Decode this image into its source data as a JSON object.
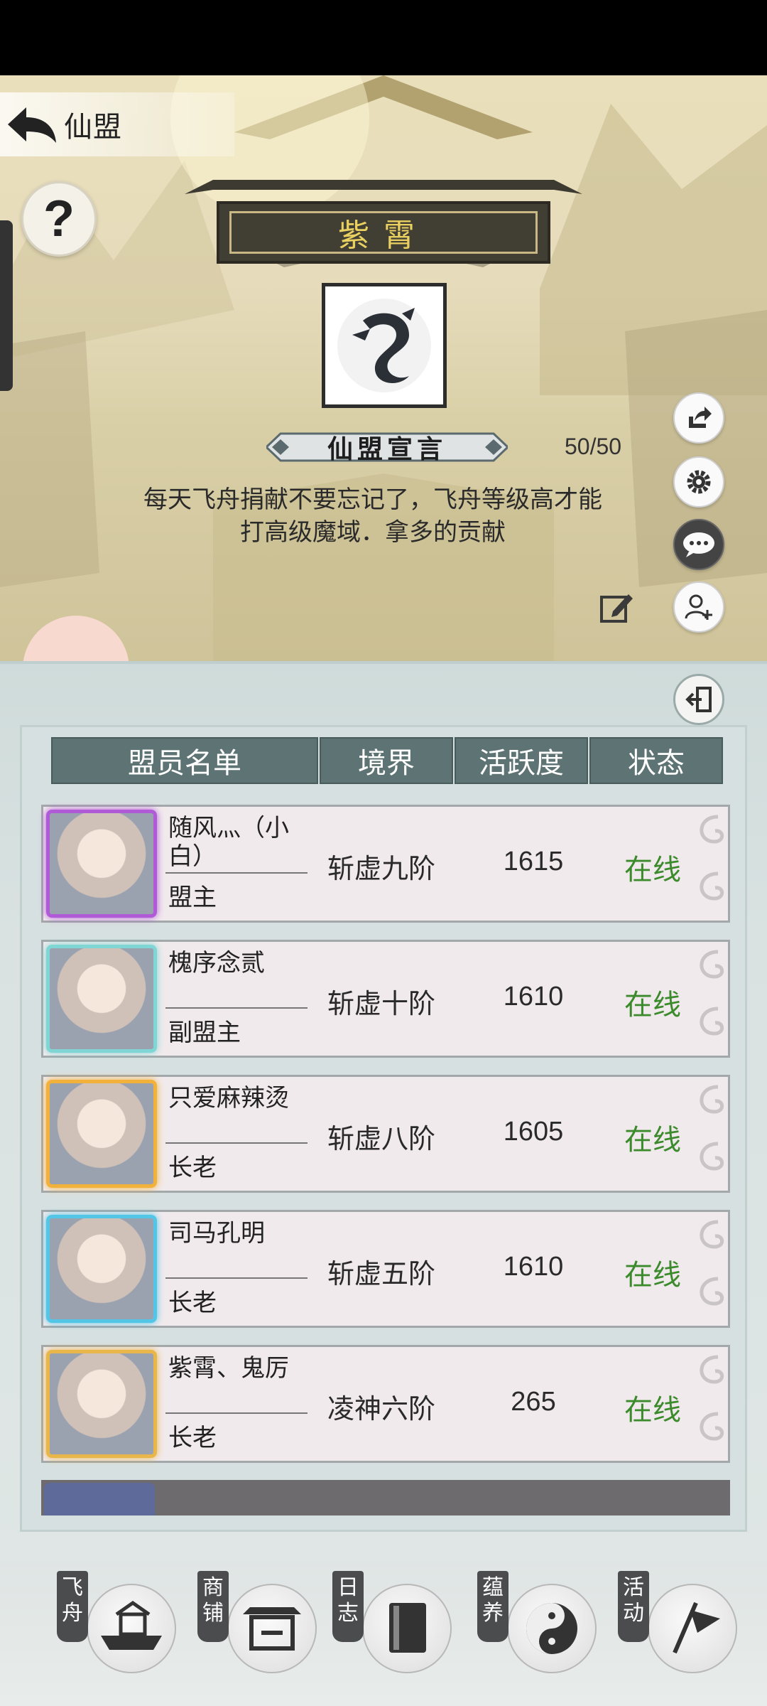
{
  "header": {
    "title": "仙盟"
  },
  "guild": {
    "name": "紫霄",
    "manifesto_title": "仙盟宣言",
    "member_count": "50/50",
    "manifesto": "每天飞舟捐献不要忘记了，飞舟等级高才能打高级魔域．拿多的贡献"
  },
  "table": {
    "headers": [
      "盟员名单",
      "境界",
      "活跃度",
      "状态"
    ],
    "rows": [
      {
        "name": "随风灬（小白）",
        "role": "盟主",
        "realm": "斩虚九阶",
        "activity": "1615",
        "status": "在线",
        "frame": "#b05ad8"
      },
      {
        "name": "槐序念贰",
        "role": "副盟主",
        "realm": "斩虚十阶",
        "activity": "1610",
        "status": "在线",
        "frame": "#7fd6d4"
      },
      {
        "name": "只爱麻辣烫",
        "role": "长老",
        "realm": "斩虚八阶",
        "activity": "1605",
        "status": "在线",
        "frame": "#f2b13a"
      },
      {
        "name": "司马孔明",
        "role": "长老",
        "realm": "斩虚五阶",
        "activity": "1610",
        "status": "在线",
        "frame": "#53c6e8"
      },
      {
        "name": "紫霄、鬼厉",
        "role": "长老",
        "realm": "凌神六阶",
        "activity": "265",
        "status": "在线",
        "frame": "#e9b64a"
      }
    ]
  },
  "nav": [
    {
      "label": "飞舟",
      "icon": "boat-icon"
    },
    {
      "label": "商铺",
      "icon": "shop-icon"
    },
    {
      "label": "日志",
      "icon": "book-icon"
    },
    {
      "label": "蕴养",
      "icon": "yin-yang-icon"
    },
    {
      "label": "活动",
      "icon": "flag-icon"
    }
  ],
  "colors": {
    "status_online": "#3b8a2c",
    "header_bg": "#5e7474",
    "plaque_text": "#e9d061"
  }
}
